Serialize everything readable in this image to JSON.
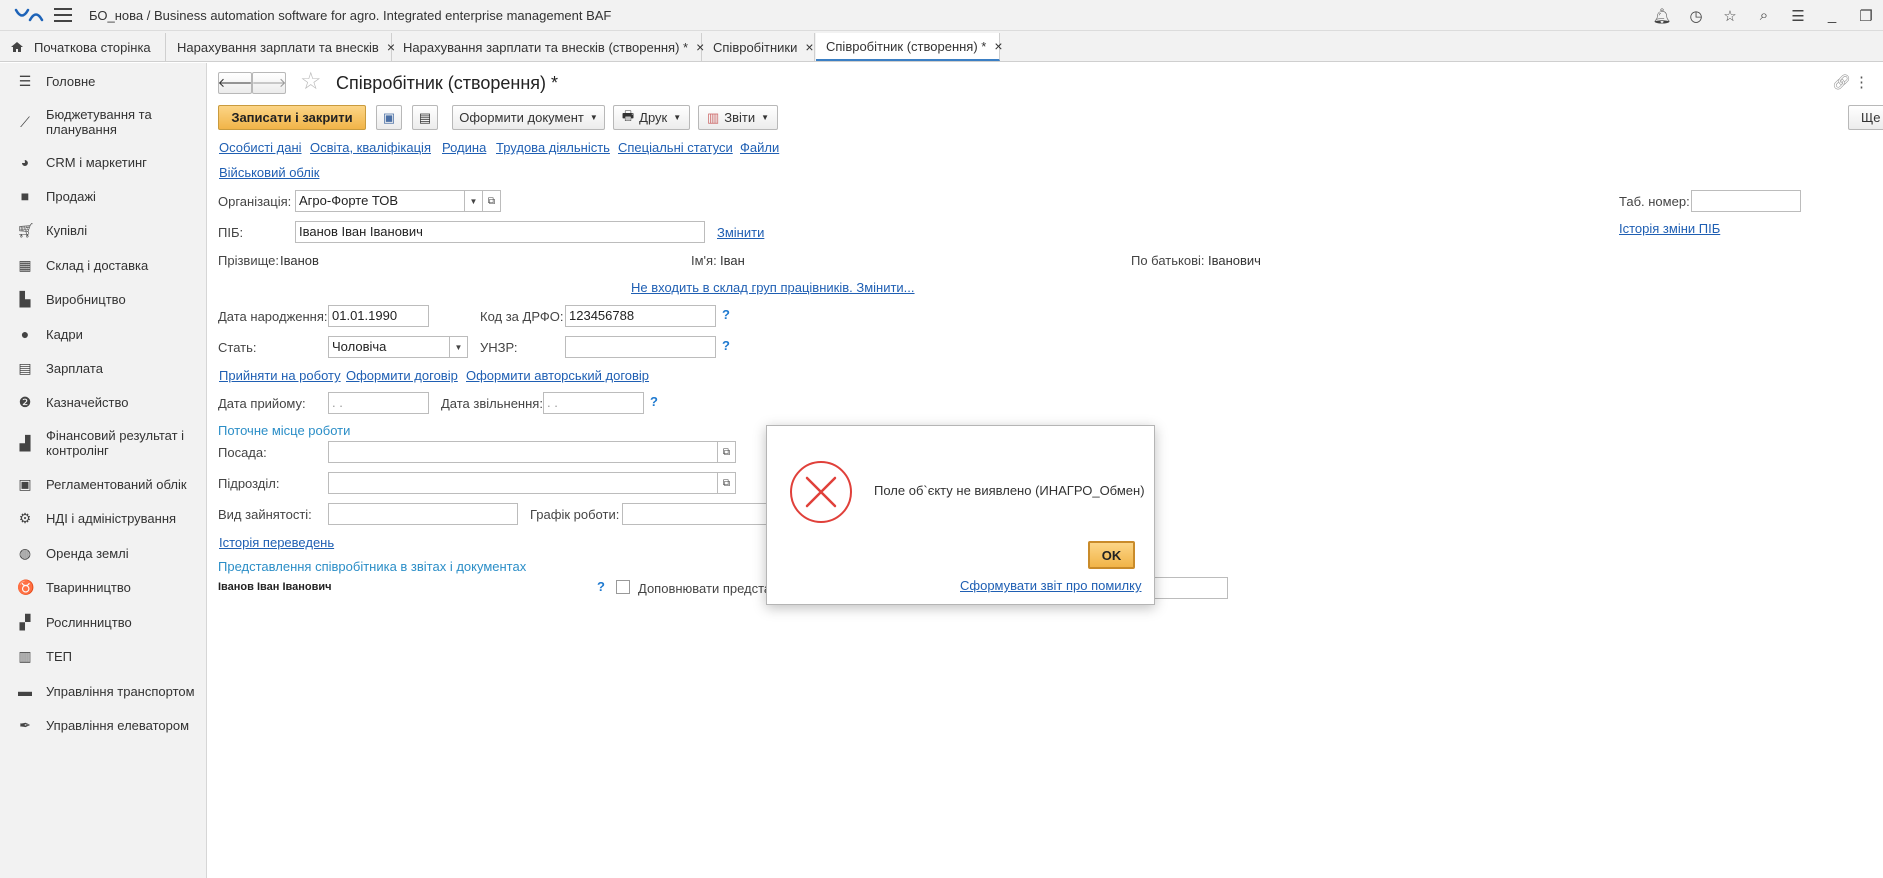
{
  "window": {
    "title": "БО_нова / Business automation software for agro. Integrated enterprise management BAF",
    "icons": [
      "bell-icon",
      "history-icon",
      "star-icon",
      "search-icon",
      "settings-icon",
      "minimize-icon",
      "restore-icon"
    ]
  },
  "tabs": [
    {
      "label": "Початкова сторінка",
      "closable": false,
      "active": false
    },
    {
      "label": "Нарахування зарплати та внесків",
      "closable": true,
      "active": false
    },
    {
      "label": "Нарахування зарплати та внесків (створення) *",
      "closable": true,
      "active": false
    },
    {
      "label": "Співробітники",
      "closable": true,
      "active": false
    },
    {
      "label": "Співробітник (створення) *",
      "closable": true,
      "active": true
    }
  ],
  "tab_close_glyph": "×",
  "sidebar": {
    "items": [
      {
        "label": "Головне",
        "icon": "menu-icon"
      },
      {
        "label": "Бюджетування та планування",
        "icon": "chart-axis-icon"
      },
      {
        "label": "CRM і маркетинг",
        "icon": "pie-chart-icon"
      },
      {
        "label": "Продажі",
        "icon": "bag-icon"
      },
      {
        "label": "Купівлі",
        "icon": "cart-icon"
      },
      {
        "label": "Склад і доставка",
        "icon": "warehouse-icon"
      },
      {
        "label": "Виробництво",
        "icon": "factory-icon"
      },
      {
        "label": "Кадри",
        "icon": "person-icon"
      },
      {
        "label": "Зарплата",
        "icon": "calculator-icon"
      },
      {
        "label": "Казначейство",
        "icon": "coin-icon"
      },
      {
        "label": "Фінансовий результат і контролінг",
        "icon": "bar-chart-icon"
      },
      {
        "label": "Регламентований облік",
        "icon": "document-icon"
      },
      {
        "label": "НДІ і адміністрування",
        "icon": "gear-icon"
      },
      {
        "label": "Оренда землі",
        "icon": "globe-icon"
      },
      {
        "label": "Тваринництво",
        "icon": "cow-icon"
      },
      {
        "label": "Рослинництво",
        "icon": "plant-icon"
      },
      {
        "label": "ТЕП",
        "icon": "tep-icon"
      },
      {
        "label": "Управління транспортом",
        "icon": "truck-icon"
      },
      {
        "label": "Управління елеватором",
        "icon": "feather-icon"
      }
    ]
  },
  "form": {
    "title": "Співробітник (створення) *",
    "toolbar": {
      "save_close": "Записати і закрити",
      "create_doc": "Оформити документ",
      "print": "Друк",
      "reports": "Звіти",
      "more": "Ще"
    },
    "nav_links": [
      "Особисті дані",
      "Освіта, кваліфікація",
      "Родина",
      "Трудова діяльність",
      "Спеціальні статуси",
      "Файли"
    ],
    "nav_link_military": "Військовий облік",
    "organization": {
      "label": "Організація:",
      "value": "Агро-Форте ТОВ"
    },
    "tab_number": {
      "label": "Таб. номер:",
      "value": ""
    },
    "name_history_link": "Історія зміни ПІБ",
    "full_name": {
      "label": "ПІБ:",
      "value": "Іванов Іван Іванович",
      "change_link": "Змінити"
    },
    "surname": {
      "label": "Прізвище:",
      "value": "Іванов"
    },
    "first_name": {
      "label": "Ім'я:",
      "value": "Іван"
    },
    "patronymic": {
      "label": "По батькові:",
      "value": "Іванович"
    },
    "groups_link": "Не входить в склад груп працівників. Змінити...",
    "birth_date": {
      "label": "Дата народження:",
      "value": "01.01.1990"
    },
    "tax_code": {
      "label": "Код за ДРФО:",
      "value": "123456788"
    },
    "gender": {
      "label": "Стать:",
      "value": "Чоловіча"
    },
    "unzr": {
      "label": "УНЗР:",
      "value": ""
    },
    "help_glyph": "?",
    "hire_links": [
      "Прийняти на роботу",
      "Оформити договір",
      "Оформити авторський договір"
    ],
    "hire_date": {
      "label": "Дата прийому:",
      "value": " .  . "
    },
    "dismiss_date": {
      "label": "Дата звільнення:",
      "value": " .  . "
    },
    "workplace_section": "Поточне місце роботи",
    "position": {
      "label": "Посада:",
      "value": ""
    },
    "department": {
      "label": "Підрозділ:",
      "value": ""
    },
    "employment_type": {
      "label": "Вид зайнятості:",
      "value": ""
    },
    "schedule": {
      "label": "Графік роботи:",
      "value": ""
    },
    "transfer_history_link": "Історія переведень",
    "representation_section": "Представлення співробітника в звітах і документах",
    "representation_name": "Іванов Іван Іванович",
    "supplement_label": "Доповнювати предста"
  },
  "dialog": {
    "message": "Поле об`єкту не виявлено (ИНАГРО_Обмен)",
    "ok": "OK",
    "report_link": "Сформувати звіт про помилку"
  }
}
